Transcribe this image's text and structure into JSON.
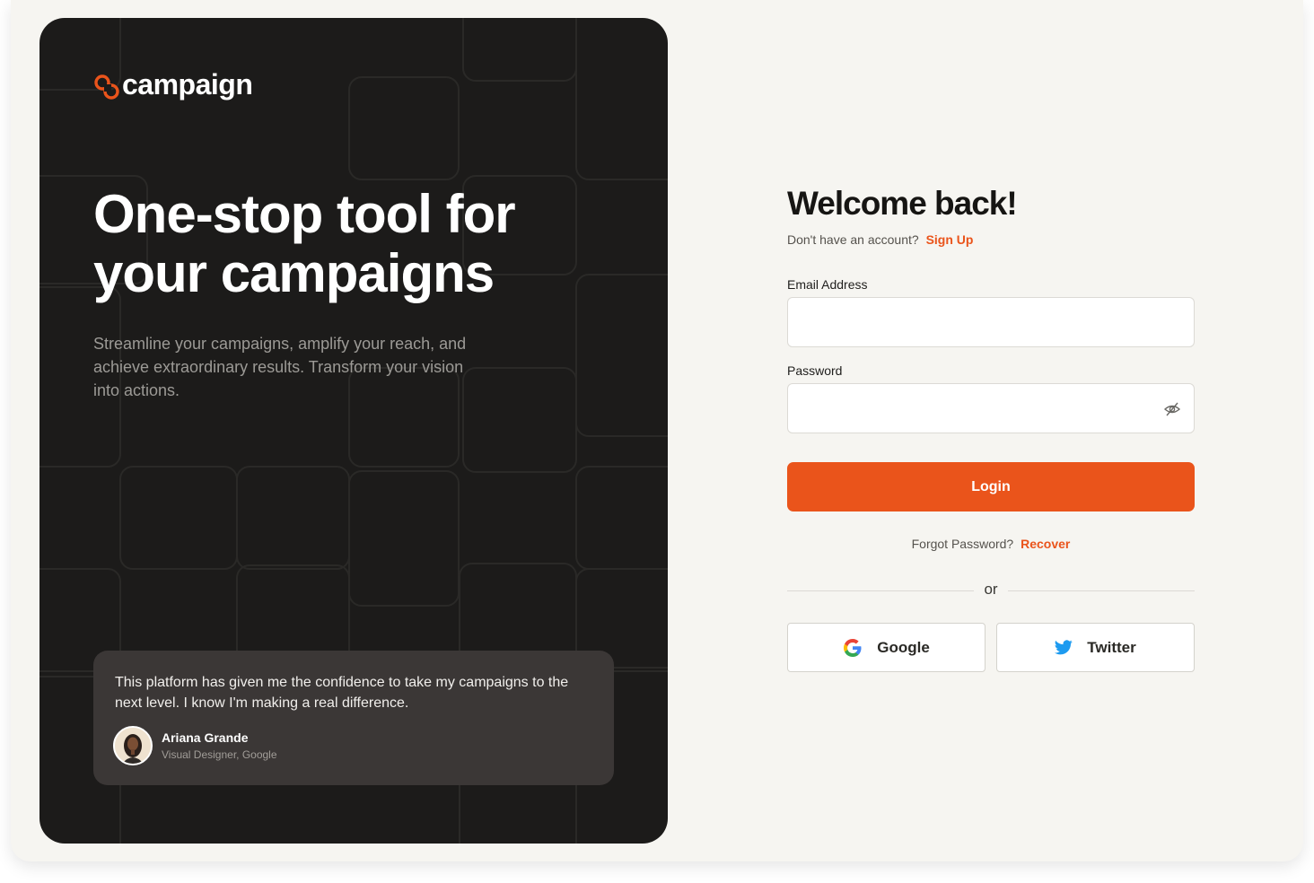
{
  "brand": {
    "name": "campaign",
    "accent_color": "#ea541b",
    "dark_bg": "#1c1b1a"
  },
  "hero": {
    "title": "One-stop tool for your campaigns",
    "subtitle": "Streamline your campaigns, amplify your reach, and achieve extraordinary results. Transform your vision into actions."
  },
  "testimonial": {
    "quote": "This platform has given me the confidence to take my campaigns to the next level. I know I'm making a real difference.",
    "author_name": "Ariana Grande",
    "author_role": "Visual Designer, Google",
    "avatar_icon": "avatar-photo"
  },
  "login": {
    "heading": "Welcome back!",
    "no_account_text": "Don't have an account?",
    "signup_link": "Sign Up",
    "email_label": "Email Address",
    "email_value": "",
    "password_label": "Password",
    "password_value": "",
    "password_toggle_icon": "eye-off-icon",
    "login_button": "Login",
    "forgot_text": "Forgot Password?",
    "recover_link": "Recover",
    "divider_text": "or",
    "social": [
      {
        "label": "Google",
        "icon": "google-icon"
      },
      {
        "label": "Twitter",
        "icon": "twitter-icon"
      }
    ]
  }
}
